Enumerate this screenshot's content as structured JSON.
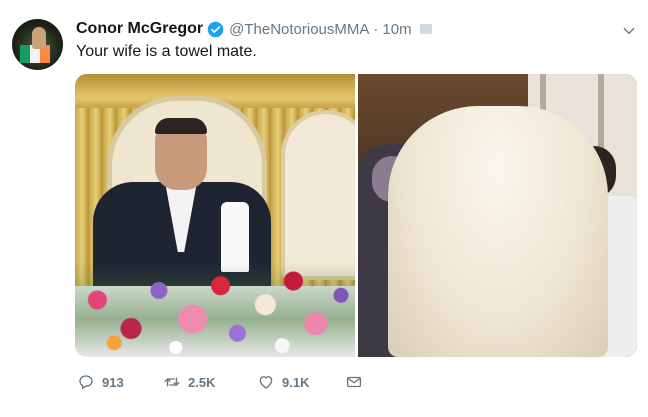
{
  "user": {
    "display_name": "Conor McGregor",
    "handle": "@TheNotoriousMMA",
    "separator": "·",
    "time": "10m",
    "verified": true,
    "avatar_icon": "profile-avatar"
  },
  "tweet": {
    "text": "Your wife is a towel mate."
  },
  "media": {
    "count": 2
  },
  "actions": {
    "reply_count": "913",
    "retweet_count": "2.5K",
    "like_count": "9.1K"
  },
  "icons": {
    "reply": "reply-icon",
    "retweet": "retweet-icon",
    "like": "heart-icon",
    "dm": "envelope-icon",
    "caret": "chevron-down-icon",
    "verified": "verified-badge-icon"
  },
  "colors": {
    "text": "#14171a",
    "secondary": "#657786",
    "verified": "#1da1f2"
  }
}
